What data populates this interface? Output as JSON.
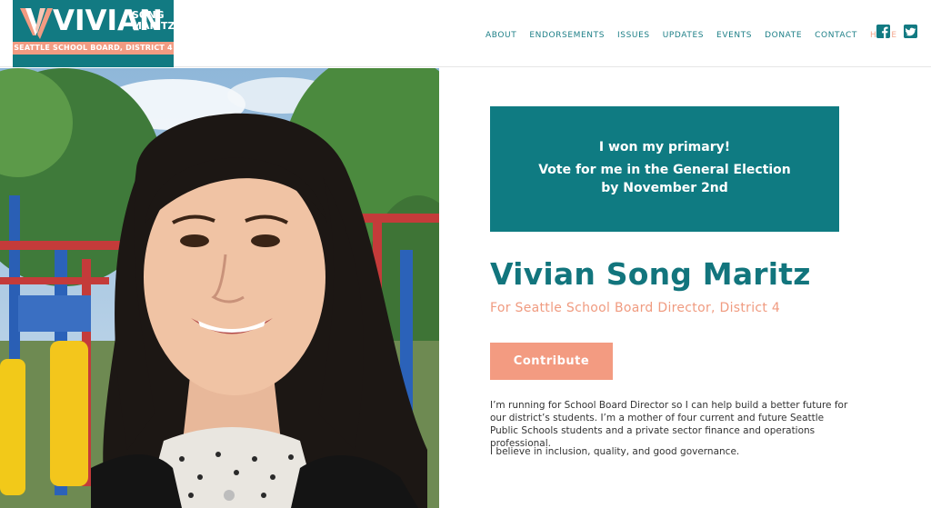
{
  "logo": {
    "name": "VIVIAN",
    "song": "SONG",
    "maritz": "MARITZ",
    "tagline": "SEATTLE SCHOOL BOARD, DISTRICT 4"
  },
  "nav": {
    "items": [
      {
        "label": "ABOUT"
      },
      {
        "label": "ENDORSEMENTS"
      },
      {
        "label": "ISSUES"
      },
      {
        "label": "UPDATES"
      },
      {
        "label": "EVENTS"
      },
      {
        "label": "DONATE"
      },
      {
        "label": "CONTACT"
      },
      {
        "label": "HOME"
      }
    ],
    "active": "HOME"
  },
  "social": {
    "facebook_icon": "facebook-icon",
    "twitter_icon": "twitter-icon"
  },
  "banner": {
    "line1": "I won my primary!",
    "line2": "Vote for me in the General Election",
    "line3": "by November 2nd"
  },
  "hero": {
    "name": "Vivian Song Maritz",
    "subtitle": "For Seattle School Board Director, District 4",
    "button": "Contribute",
    "paragraph1": "I’m running for School Board Director so I can help build a better future for our district’s students. I’m a mother of four current and future Seattle Public Schools students and a private sector finance and operations professional.",
    "paragraph2": "I believe in inclusion, quality, and good governance."
  },
  "colors": {
    "teal": "#127a82",
    "salmon": "#f39b81"
  }
}
